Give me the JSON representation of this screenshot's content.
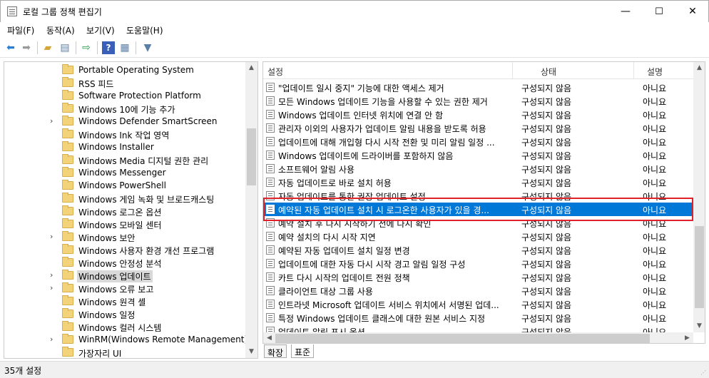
{
  "window": {
    "title": "로컬 그룹 정책 편집기",
    "minimize": "—",
    "maximize": "☐",
    "close": "✕"
  },
  "menu": [
    {
      "label": "파일(F)"
    },
    {
      "label": "동작(A)"
    },
    {
      "label": "보기(V)"
    },
    {
      "label": "도움말(H)"
    }
  ],
  "toolbar": {
    "icons": [
      "back-icon",
      "forward-icon",
      "up-folder-icon",
      "show-hide-tree-icon",
      "export-list-icon",
      "help-icon",
      "properties-icon",
      "filter-icon"
    ]
  },
  "tree": {
    "items": [
      {
        "label": "Portable Operating System",
        "expandable": false
      },
      {
        "label": "RSS 피드",
        "expandable": false
      },
      {
        "label": "Software Protection Platform",
        "expandable": false
      },
      {
        "label": "Windows 10에 기능 추가",
        "expandable": false
      },
      {
        "label": "Windows Defender SmartScreen",
        "expandable": true
      },
      {
        "label": "Windows Ink 작업 영역",
        "expandable": false
      },
      {
        "label": "Windows Installer",
        "expandable": false
      },
      {
        "label": "Windows Media 디지털 권한 관리",
        "expandable": false
      },
      {
        "label": "Windows Messenger",
        "expandable": false
      },
      {
        "label": "Windows PowerShell",
        "expandable": false
      },
      {
        "label": "Windows 게임 녹화 및 브로드캐스팅",
        "expandable": false
      },
      {
        "label": "Windows 로그온 옵션",
        "expandable": false
      },
      {
        "label": "Windows 모바일 센터",
        "expandable": false
      },
      {
        "label": "Windows 보안",
        "expandable": true
      },
      {
        "label": "Windows 사용자 환경 개선 프로그램",
        "expandable": false
      },
      {
        "label": "Windows 안정성 분석",
        "expandable": false
      },
      {
        "label": "Windows 업데이트",
        "expandable": true,
        "selected": true
      },
      {
        "label": "Windows 오류 보고",
        "expandable": true
      },
      {
        "label": "Windows 원격 셸",
        "expandable": false
      },
      {
        "label": "Windows 일정",
        "expandable": false
      },
      {
        "label": "Windows 컬러 시스템",
        "expandable": false
      },
      {
        "label": "WinRM(Windows Remote Management)",
        "expandable": true
      },
      {
        "label": "가장자리 UI",
        "expandable": false
      }
    ]
  },
  "list": {
    "headers": {
      "setting": "설정",
      "state": "상태",
      "comment": "설명"
    },
    "rows": [
      {
        "name": "\"업데이트 일시 중지\" 기능에 대한 액세스 제거",
        "state": "구성되지 않음",
        "comment": "아니요"
      },
      {
        "name": "모든 Windows 업데이트 기능을 사용할 수 있는 권한 제거",
        "state": "구성되지 않음",
        "comment": "아니요"
      },
      {
        "name": "Windows 업데이트 인터넷 위치에 연결 안 함",
        "state": "구성되지 않음",
        "comment": "아니요"
      },
      {
        "name": "관리자 이외의 사용자가 업데이트 알림 내용을 받도록 허용",
        "state": "구성되지 않음",
        "comment": "아니요"
      },
      {
        "name": "업데이트에 대해 개입형 다시 시작 전환 및 미리 알림 일정 ...",
        "state": "구성되지 않음",
        "comment": "아니요"
      },
      {
        "name": "Windows 업데이트에 드라이버를 포함하지 않음",
        "state": "구성되지 않음",
        "comment": "아니요"
      },
      {
        "name": "소프트웨어 알림 사용",
        "state": "구성되지 않음",
        "comment": "아니요"
      },
      {
        "name": "자동 업데이트로 바로 설치 허용",
        "state": "구성되지 않음",
        "comment": "아니요"
      },
      {
        "name": "자동 업데이트를 통한 권장 업데이트 설정",
        "state": "구성되지 않음",
        "comment": "아니요"
      },
      {
        "name": "예약된 자동 업데이트 설치 시 로그온한 사용자가 있을 경...",
        "state": "구성되지 않음",
        "comment": "아니요",
        "selected": true
      },
      {
        "name": "예약 설치 후 다시 시작하기 전에 다시 확인",
        "state": "구성되지 않음",
        "comment": "아니요"
      },
      {
        "name": "예약 설치의 다시 시작 지연",
        "state": "구성되지 않음",
        "comment": "아니요"
      },
      {
        "name": "예약된 자동 업데이트 설치 일정 변경",
        "state": "구성되지 않음",
        "comment": "아니요"
      },
      {
        "name": "업데이트에 대한 자동 다시 시작 경고 알림 일정 구성",
        "state": "구성되지 않음",
        "comment": "아니요"
      },
      {
        "name": "카트 다시 시작의 업데이트 전원 정책",
        "state": "구성되지 않음",
        "comment": "아니요"
      },
      {
        "name": "클라이언트 대상 그룹 사용",
        "state": "구성되지 않음",
        "comment": "아니요"
      },
      {
        "name": "인트라넷 Microsoft 업데이트 서비스 위치에서 서명된 업데...",
        "state": "구성되지 않음",
        "comment": "아니요"
      },
      {
        "name": "특정 Windows 업데이트 클래스에 대한 원본 서비스 지정",
        "state": "구성되지 않음",
        "comment": "아니요"
      },
      {
        "name": "업데이트 알림 표시 옵션",
        "state": "구성되지 않음",
        "comment": "아니요"
      }
    ]
  },
  "tabs": [
    {
      "label": "확장"
    },
    {
      "label": "표준",
      "active": true
    }
  ],
  "status": {
    "text": "35개 설정"
  },
  "colors": {
    "selection": "#0078d7",
    "highlight_box": "#e0202a"
  }
}
